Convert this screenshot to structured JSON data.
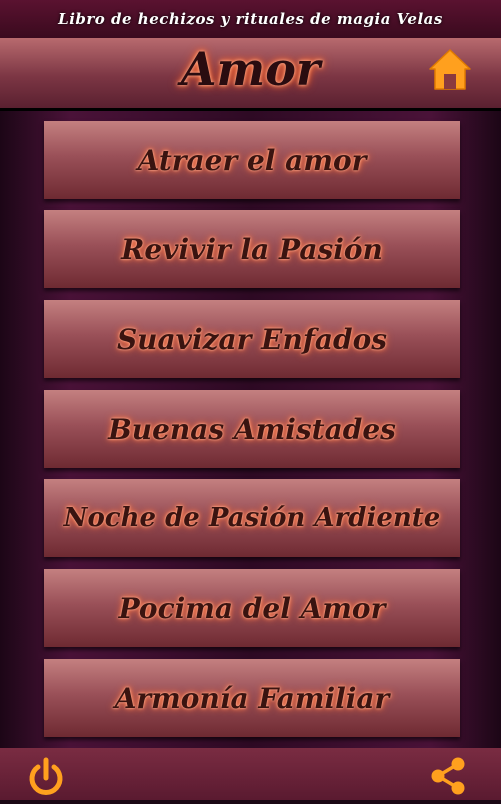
{
  "app": {
    "title": "Libro de hechizos y rituales de magia Velas"
  },
  "header": {
    "title": "Amor",
    "home_icon": "home-icon"
  },
  "menu": {
    "items": [
      {
        "label": "Atraer el amor"
      },
      {
        "label": "Revivir la Pasión"
      },
      {
        "label": "Suavizar Enfados"
      },
      {
        "label": "Buenas Amistades"
      },
      {
        "label": "Noche de Pasión Ardiente"
      },
      {
        "label": "Pocima del Amor"
      },
      {
        "label": "Armonía Familiar"
      }
    ]
  },
  "footer": {
    "power_icon": "power-icon",
    "share_icon": "share-icon"
  },
  "colors": {
    "accent": "#ff9a1a",
    "header": "#7c3644",
    "button": "#9a5058"
  }
}
